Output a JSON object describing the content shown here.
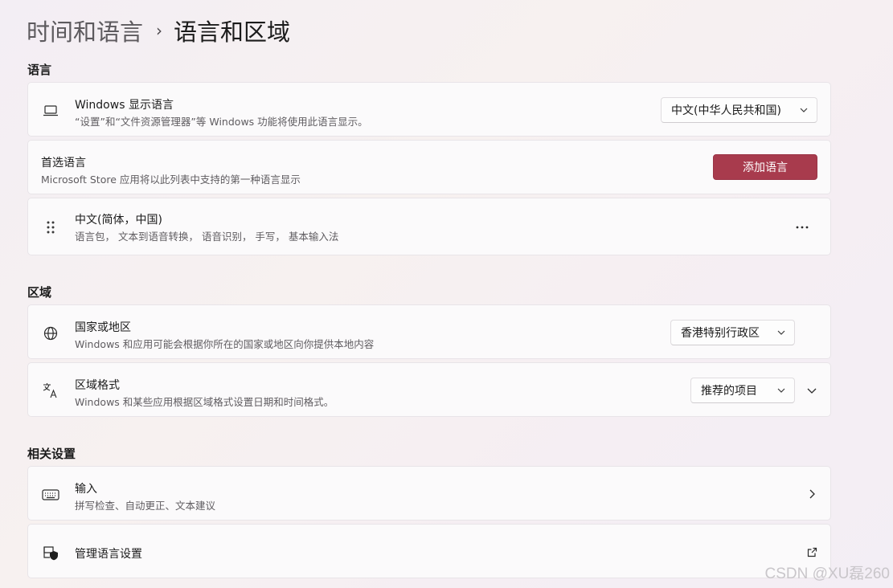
{
  "breadcrumb": {
    "parent": "时间和语言",
    "separator": "›",
    "current": "语言和区域"
  },
  "sections": {
    "language": "语言",
    "region": "区域",
    "related": "相关设置"
  },
  "display_language": {
    "icon": "laptop-icon",
    "title": "Windows 显示语言",
    "desc": "“设置”和“文件资源管理器”等 Windows 功能将使用此语言显示。",
    "selected": "中文(中华人民共和国)"
  },
  "preferred_language": {
    "title": "首选语言",
    "desc": "Microsoft Store 应用将以此列表中支持的第一种语言显示",
    "button_label": "添加语言"
  },
  "language_item": {
    "icon": "drag-handle-icon",
    "title": "中文(简体，中国)",
    "desc": "语言包， 文本到语音转换， 语音识别， 手写， 基本输入法",
    "more_icon": "more-options-icon"
  },
  "country_region": {
    "icon": "globe-icon",
    "title": "国家或地区",
    "desc": "Windows 和应用可能会根据你所在的国家或地区向你提供本地内容",
    "selected": "香港特别行政区"
  },
  "regional_format": {
    "icon": "language-format-icon",
    "title": "区域格式",
    "desc": "Windows 和某些应用根据区域格式设置日期和时间格式。",
    "selected": "推荐的项目",
    "expand_icon": "chevron-down-icon"
  },
  "typing": {
    "icon": "keyboard-icon",
    "title": "输入",
    "desc": "拼写检查、自动更正、文本建议",
    "nav_icon": "chevron-right-icon"
  },
  "admin_language": {
    "icon": "shield-icon",
    "title": "管理语言设置",
    "nav_icon": "external-link-icon"
  },
  "watermark": "CSDN @XU磊260",
  "colors": {
    "accent": "#a83b4d",
    "card_bg": "#fbfafb",
    "card_border": "#e8e4e8",
    "text_primary": "#1b1b1b",
    "text_secondary": "#5f5c60"
  }
}
